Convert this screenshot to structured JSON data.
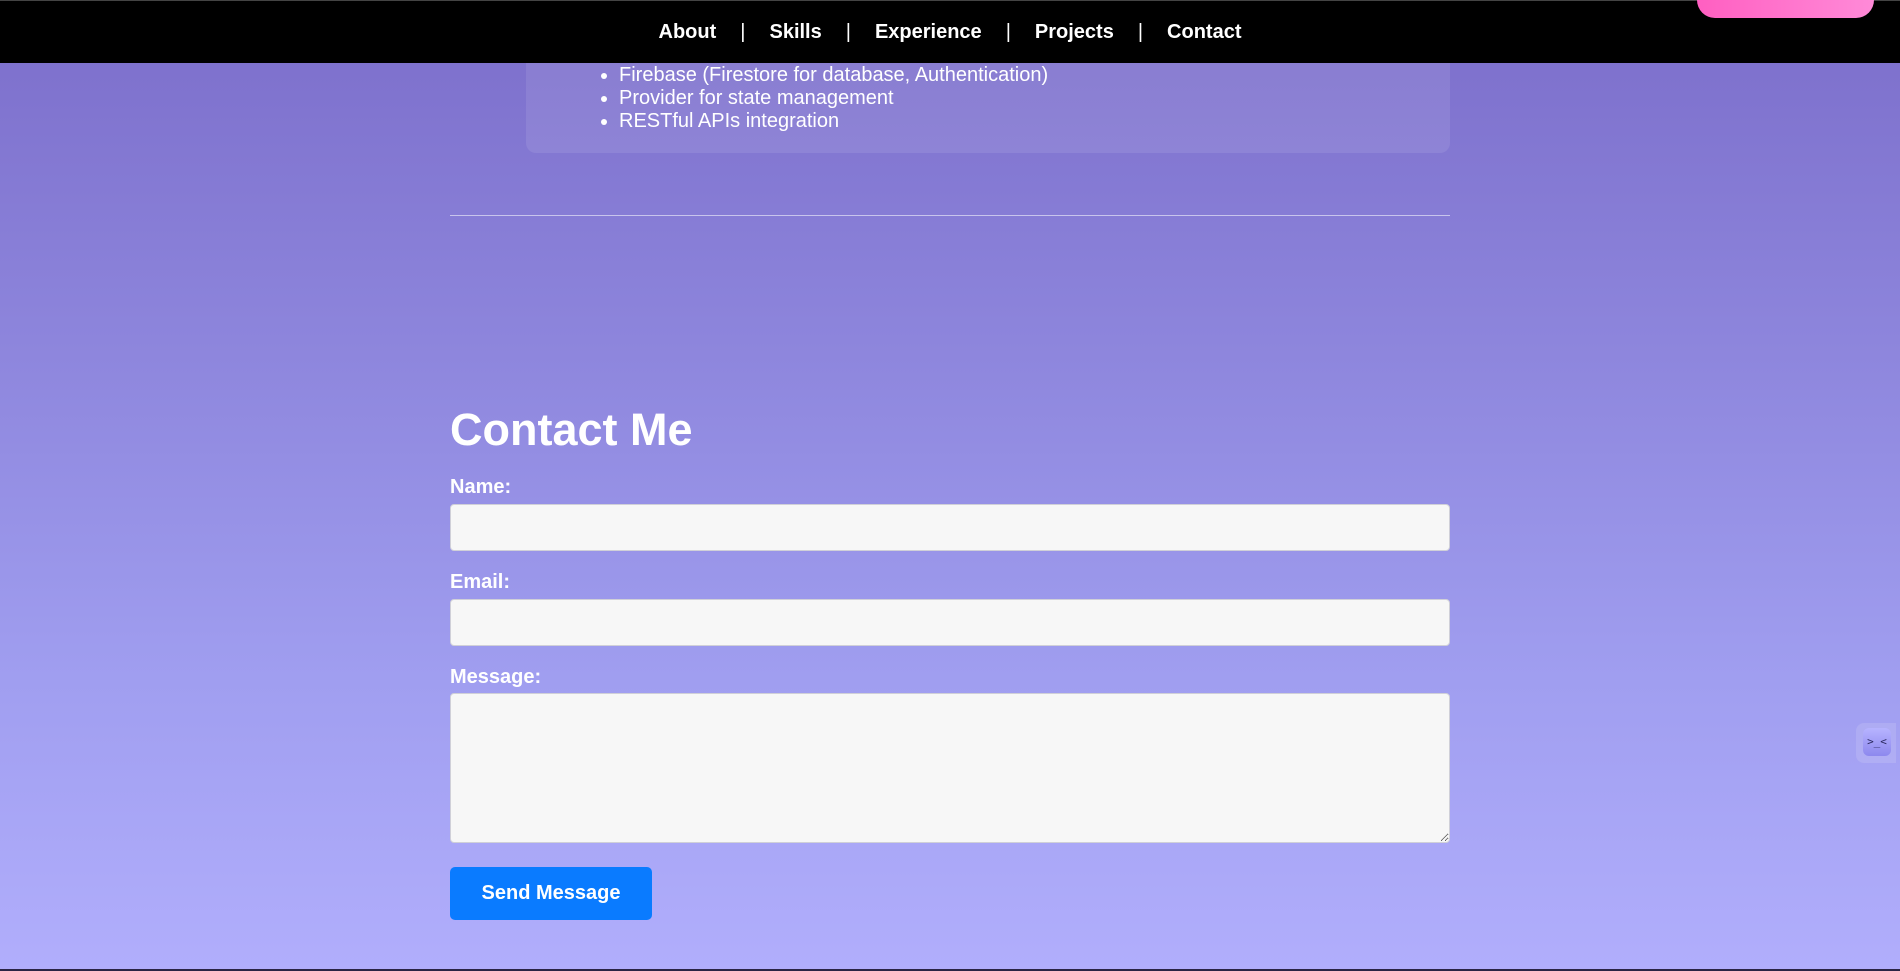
{
  "nav": {
    "items": [
      {
        "label": "About"
      },
      {
        "label": "Skills"
      },
      {
        "label": "Experience"
      },
      {
        "label": "Projects"
      },
      {
        "label": "Contact"
      }
    ],
    "separator": "|"
  },
  "skills": {
    "items": [
      "Firebase (Firestore for database, Authentication)",
      "Provider for state management",
      "RESTful APIs integration"
    ]
  },
  "contact": {
    "title": "Contact Me",
    "name_label": "Name:",
    "name_value": "",
    "email_label": "Email:",
    "email_value": "",
    "message_label": "Message:",
    "message_value": "",
    "submit_label": "Send Message"
  },
  "widget": {
    "face": ">_<"
  },
  "colors": {
    "nav_background": "#000000",
    "button_background": "#0a7bff",
    "pill_accent": "#ff5fc1",
    "page_gradient_top": "#7b6dca",
    "page_gradient_bottom": "#b1aefc"
  }
}
